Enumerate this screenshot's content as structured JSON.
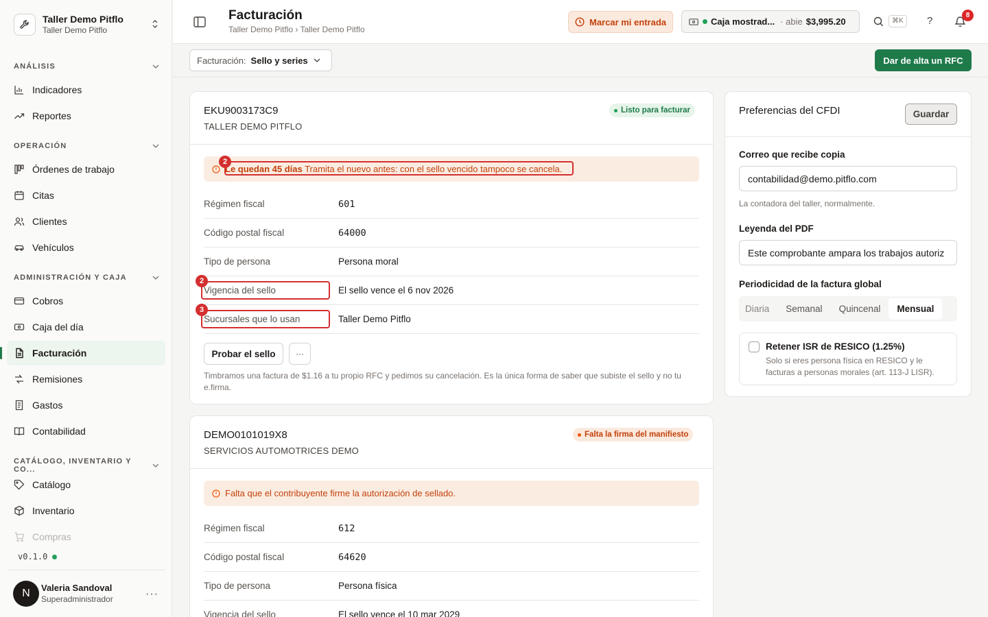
{
  "sidebar": {
    "org_name": "Taller Demo Pitflo",
    "org_sub": "Taller Demo Pitflo",
    "sections": {
      "analisis": "ANÁLISIS",
      "operacion": "OPERACIÓN",
      "admin": "ADMINISTRACIÓN Y CAJA",
      "catalogo": "CATÁLOGO, INVENTARIO Y CO..."
    },
    "items": {
      "indicadores": "Indicadores",
      "reportes": "Reportes",
      "ordenes": "Órdenes de trabajo",
      "citas": "Citas",
      "clientes": "Clientes",
      "vehiculos": "Vehículos",
      "cobros": "Cobros",
      "caja": "Caja del día",
      "facturacion": "Facturación",
      "remisiones": "Remisiones",
      "gastos": "Gastos",
      "contabilidad": "Contabilidad",
      "catalogo": "Catálogo",
      "inventario": "Inventario",
      "compras": "Compras"
    },
    "version": "v0.1.0",
    "user": {
      "initial": "N",
      "name": "Valeria Sandoval",
      "role": "Superadministrador"
    }
  },
  "header": {
    "title": "Facturación",
    "breadcrumb": "Taller Demo Pitflo › Taller Demo Pitflo",
    "entry_button": "Marcar mi entrada",
    "caja_name": "Caja mostrad...",
    "caja_state": "· abie",
    "caja_amount": "$3,995.20",
    "shortcut": "⌘K",
    "help": "?",
    "notifications": "8"
  },
  "toolbar": {
    "select_label": "Facturación:",
    "select_value": "Sello y series",
    "add_rfc_button": "Dar de alta un RFC"
  },
  "rfc_cards": [
    {
      "rfc": "EKU9003173C9",
      "name": "TALLER DEMO PITFLO",
      "status": "Listo para facturar",
      "alert_bold": "Le quedan 45 días",
      "alert_text": " Tramita el nuevo antes: con el sello vencido tampoco se cancela.",
      "rows": [
        {
          "label": "Régimen fiscal",
          "value": "601"
        },
        {
          "label": "Código postal fiscal",
          "value": "64000"
        },
        {
          "label": "Tipo de persona",
          "value": "Persona moral"
        },
        {
          "label": "Vigencia del sello",
          "value": "El sello vence el 6 nov 2026"
        },
        {
          "label": "Sucursales que lo usan",
          "value": "Taller Demo Pitflo"
        }
      ],
      "test_button": "Probar el sello",
      "more_button": "···",
      "help_text": "Timbramos una factura de $1.16 a tu propio RFC y pedimos su cancelación. Es la única forma de saber que subiste el sello y no tu e.firma."
    },
    {
      "rfc": "DEMO0101019X8",
      "name": "SERVICIOS AUTOMOTRICES DEMO",
      "status": "Falta la firma del manifiesto",
      "alert_text": "Falta que el contribuyente firme la autorización de sellado.",
      "rows": [
        {
          "label": "Régimen fiscal",
          "value": "612"
        },
        {
          "label": "Código postal fiscal",
          "value": "64620"
        },
        {
          "label": "Tipo de persona",
          "value": "Persona física"
        },
        {
          "label": "Vigencia del sello",
          "value": "El sello vence el 10 mar 2029"
        }
      ]
    }
  ],
  "annotations": {
    "alert_num": "2",
    "vigencia_num": "2",
    "sucursales_num": "3"
  },
  "preferences": {
    "title": "Preferencias del CFDI",
    "save_button": "Guardar",
    "email_label": "Correo que recibe copia",
    "email_value": "contabilidad@demo.pitflo.com",
    "email_hint": "La contadora del taller, normalmente.",
    "legend_label": "Leyenda del PDF",
    "legend_value": "Este comprobante ampara los trabajos autoriz",
    "period_label": "Periodicidad de la factura global",
    "period_options": [
      "Diaria",
      "Semanal",
      "Quincenal",
      "Mensual"
    ],
    "period_selected": "Mensual",
    "resico_title": "Retener ISR de RESICO (1.25%)",
    "resico_desc": "Solo si eres persona física en RESICO y le facturas a personas morales (art. 113-J LISR).",
    "resico_checked": false
  },
  "colors": {
    "brand_green": "#1f7a4a",
    "warning_orange": "#c2410c",
    "annotation_red": "#d32f2f"
  }
}
